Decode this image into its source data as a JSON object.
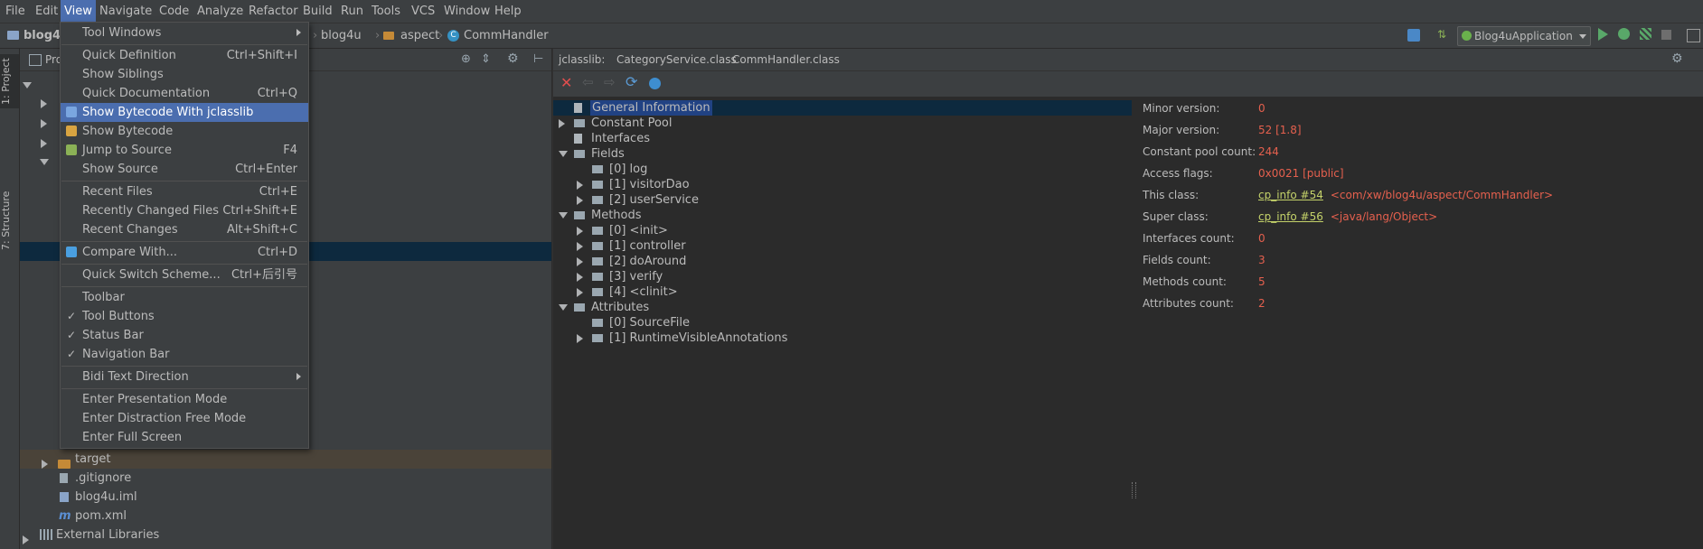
{
  "menubar": {
    "items": [
      "File",
      "Edit",
      "View",
      "Navigate",
      "Code",
      "Analyze",
      "Refactor",
      "Build",
      "Run",
      "Tools",
      "VCS",
      "Window",
      "Help"
    ],
    "active": "View"
  },
  "navbar": {
    "project": "blog4u",
    "crumbs": [
      "blog4u",
      "aspect",
      "CommHandler"
    ],
    "run_config": "Blog4uApplication"
  },
  "left_stripe": {
    "tabs": [
      "1: Project",
      "7: Structure"
    ]
  },
  "project_panel": {
    "title": "Pro",
    "rows": [
      {
        "label": "target",
        "type": "folder",
        "expand": "right"
      },
      {
        "label": ".gitignore",
        "type": "file"
      },
      {
        "label": "blog4u.iml",
        "type": "file"
      },
      {
        "label": "pom.xml",
        "type": "file",
        "prefix": "m"
      },
      {
        "label": "External Libraries",
        "type": "lib",
        "expand": "right"
      }
    ]
  },
  "view_menu": {
    "items": [
      {
        "label": "Tool Windows",
        "shortcut": "",
        "submenu": true
      },
      {
        "sep": true
      },
      {
        "label": "Quick Definition",
        "shortcut": "Ctrl+Shift+I"
      },
      {
        "label": "Show Siblings",
        "shortcut": ""
      },
      {
        "label": "Quick Documentation",
        "shortcut": "Ctrl+Q"
      },
      {
        "label": "Show Bytecode With jclasslib",
        "shortcut": "",
        "highlight": true,
        "icon": "jclasslib-icon"
      },
      {
        "label": "Show Bytecode",
        "shortcut": "",
        "icon": "bytecode-icon"
      },
      {
        "label": "Jump to Source",
        "shortcut": "F4",
        "icon": "jump-icon"
      },
      {
        "label": "Show Source",
        "shortcut": "Ctrl+Enter"
      },
      {
        "sep": true
      },
      {
        "label": "Recent Files",
        "shortcut": "Ctrl+E"
      },
      {
        "label": "Recently Changed Files",
        "shortcut": "Ctrl+Shift+E"
      },
      {
        "label": "Recent Changes",
        "shortcut": "Alt+Shift+C"
      },
      {
        "sep": true
      },
      {
        "label": "Compare With...",
        "shortcut": "Ctrl+D",
        "icon": "compare-icon"
      },
      {
        "sep": true
      },
      {
        "label": "Quick Switch Scheme...",
        "shortcut": "Ctrl+后引号"
      },
      {
        "sep": true
      },
      {
        "label": "Toolbar",
        "shortcut": ""
      },
      {
        "label": "Tool Buttons",
        "shortcut": "",
        "check": true
      },
      {
        "label": "Status Bar",
        "shortcut": "",
        "check": true
      },
      {
        "label": "Navigation Bar",
        "shortcut": "",
        "check": true
      },
      {
        "sep": true
      },
      {
        "label": "Bidi Text Direction",
        "shortcut": "",
        "submenu": true
      },
      {
        "sep": true
      },
      {
        "label": "Enter Presentation Mode",
        "shortcut": ""
      },
      {
        "label": "Enter Distraction Free Mode",
        "shortcut": ""
      },
      {
        "label": "Enter Full Screen",
        "shortcut": ""
      }
    ]
  },
  "editor": {
    "tabs": [
      "jclasslib:",
      "CategoryService.class",
      "CommHandler.class"
    ],
    "tree": [
      {
        "label": "General Information",
        "level": 0,
        "selected": true
      },
      {
        "label": "Constant Pool",
        "level": 0,
        "expand": "right",
        "folder": true
      },
      {
        "label": "Interfaces",
        "level": 0
      },
      {
        "label": "Fields",
        "level": 0,
        "expand": "down",
        "folder": true
      },
      {
        "label": "[0] log",
        "level": 1,
        "folder": true
      },
      {
        "label": "[1] visitorDao",
        "level": 1,
        "expand": "right",
        "folder": true
      },
      {
        "label": "[2] userService",
        "level": 1,
        "expand": "right",
        "folder": true
      },
      {
        "label": "Methods",
        "level": 0,
        "expand": "down",
        "folder": true
      },
      {
        "label": "[0] <init>",
        "level": 1,
        "expand": "right",
        "folder": true
      },
      {
        "label": "[1] controller",
        "level": 1,
        "expand": "right",
        "folder": true
      },
      {
        "label": "[2] doAround",
        "level": 1,
        "expand": "right",
        "folder": true
      },
      {
        "label": "[3] verify",
        "level": 1,
        "expand": "right",
        "folder": true
      },
      {
        "label": "[4] <clinit>",
        "level": 1,
        "expand": "right",
        "folder": true
      },
      {
        "label": "Attributes",
        "level": 0,
        "expand": "down",
        "folder": true
      },
      {
        "label": "[0] SourceFile",
        "level": 1,
        "folder": true
      },
      {
        "label": "[1] RuntimeVisibleAnnotations",
        "level": 1,
        "expand": "right",
        "folder": true
      }
    ],
    "info": [
      {
        "key": "Minor version:",
        "value": "0"
      },
      {
        "key": "Major version:",
        "value": "52 [1.8]"
      },
      {
        "key": "Constant pool count:",
        "value": "244"
      },
      {
        "key": "Access flags:",
        "value": "0x0021 [public]"
      },
      {
        "key": "This class:",
        "link": "cp_info #54",
        "value": "<com/xw/blog4u/aspect/CommHandler>"
      },
      {
        "key": "Super class:",
        "link": "cp_info #56",
        "value": "<java/lang/Object>"
      },
      {
        "key": "Interfaces count:",
        "value": "0"
      },
      {
        "key": "Fields count:",
        "value": "3"
      },
      {
        "key": "Methods count:",
        "value": "5"
      },
      {
        "key": "Attributes count:",
        "value": "2"
      }
    ]
  },
  "colors": {
    "bg_dark": "#2b2b2b",
    "bg_panel": "#3c3f41",
    "highlight": "#4b6eaf",
    "value_red": "#e5604e",
    "link_green": "#c5d36a",
    "folder": "#c58a37"
  }
}
